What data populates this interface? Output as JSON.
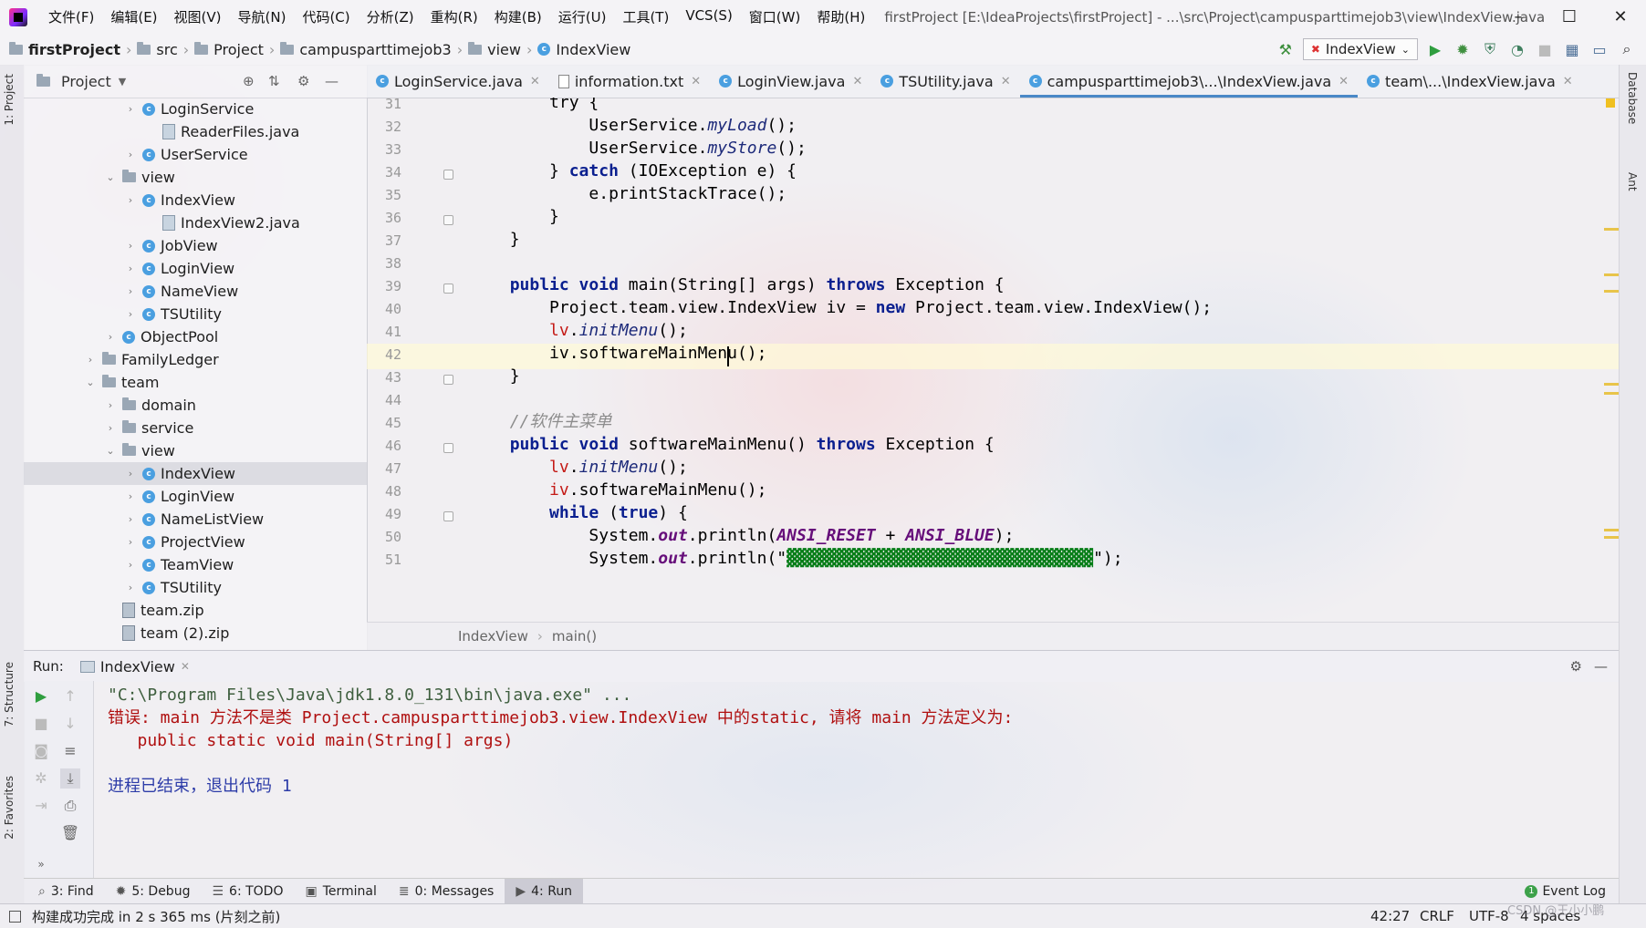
{
  "window": {
    "menus": [
      "文件(F)",
      "编辑(E)",
      "视图(V)",
      "导航(N)",
      "代码(C)",
      "分析(Z)",
      "重构(R)",
      "构建(B)",
      "运行(U)",
      "工具(T)",
      "VCS(S)",
      "窗口(W)",
      "帮助(H)"
    ],
    "title": "firstProject [E:\\IdeaProjects\\firstProject] - ...\\src\\Project\\campusparttimejob3\\view\\IndexView.java"
  },
  "navbar": {
    "crumbs": [
      "firstProject",
      "src",
      "Project",
      "campusparttimejob3",
      "view",
      "IndexView"
    ],
    "run_config": "IndexView"
  },
  "left_stripe": {
    "project": "1: Project",
    "structure": "7: Structure",
    "favorites": "2: Favorites"
  },
  "right_stripe": {
    "database": "Database",
    "ant": "Ant"
  },
  "project_panel": {
    "title": "Project",
    "tree": [
      {
        "label": "LoginService",
        "kind": "class",
        "arrow": "›"
      },
      {
        "label": "ReaderFiles.java",
        "kind": "file",
        "arrow": ""
      },
      {
        "label": "UserService",
        "kind": "class",
        "arrow": "›"
      },
      {
        "label": "view",
        "kind": "folder",
        "arrow": "⌄"
      },
      {
        "label": "IndexView",
        "kind": "class",
        "arrow": "›"
      },
      {
        "label": "IndexView2.java",
        "kind": "file",
        "arrow": ""
      },
      {
        "label": "JobView",
        "kind": "class",
        "arrow": "›"
      },
      {
        "label": "LoginView",
        "kind": "class",
        "arrow": "›"
      },
      {
        "label": "NameView",
        "kind": "class",
        "arrow": "›"
      },
      {
        "label": "TSUtility",
        "kind": "class",
        "arrow": "›"
      },
      {
        "label": "ObjectPool",
        "kind": "class",
        "arrow": "›"
      },
      {
        "label": "FamilyLedger",
        "kind": "folder",
        "arrow": "›"
      },
      {
        "label": "team",
        "kind": "folder",
        "arrow": "⌄"
      },
      {
        "label": "domain",
        "kind": "folder",
        "arrow": "›"
      },
      {
        "label": "service",
        "kind": "folder",
        "arrow": "›"
      },
      {
        "label": "view",
        "kind": "folder",
        "arrow": "⌄"
      },
      {
        "label": "IndexView",
        "kind": "class",
        "arrow": "›"
      },
      {
        "label": "LoginView",
        "kind": "class",
        "arrow": "›"
      },
      {
        "label": "NameListView",
        "kind": "class",
        "arrow": "›"
      },
      {
        "label": "ProjectView",
        "kind": "class",
        "arrow": "›"
      },
      {
        "label": "TeamView",
        "kind": "class",
        "arrow": "›"
      },
      {
        "label": "TSUtility",
        "kind": "class",
        "arrow": "›"
      },
      {
        "label": "team.zip",
        "kind": "zip",
        "arrow": ""
      },
      {
        "label": "team (2).zip",
        "kind": "zip",
        "arrow": ""
      }
    ]
  },
  "editor_tabs": [
    {
      "label": "LoginService.java",
      "icon": "class"
    },
    {
      "label": "information.txt",
      "icon": "text"
    },
    {
      "label": "LoginView.java",
      "icon": "class"
    },
    {
      "label": "TSUtility.java",
      "icon": "class"
    },
    {
      "label": "campusparttimejob3\\...\\IndexView.java",
      "icon": "class",
      "active": true
    },
    {
      "label": "team\\...\\IndexView.java",
      "icon": "class"
    }
  ],
  "editor": {
    "line_numbers": [
      "31",
      "32",
      "33",
      "34",
      "35",
      "36",
      "37",
      "38",
      "39",
      "40",
      "41",
      "42",
      "43",
      "44",
      "45",
      "46",
      "47",
      "48",
      "49",
      "50",
      "51"
    ],
    "lines": [
      [
        {
          "t": "            try {",
          "c": ""
        }
      ],
      [
        {
          "t": "                UserService.",
          "c": ""
        },
        {
          "t": "myLoad",
          "c": "fn-i"
        },
        {
          "t": "();",
          "c": ""
        }
      ],
      [
        {
          "t": "                UserService.",
          "c": ""
        },
        {
          "t": "myStore",
          "c": "fn-i"
        },
        {
          "t": "();",
          "c": ""
        }
      ],
      [
        {
          "t": "            } ",
          "c": ""
        },
        {
          "t": "catch",
          "c": "kw"
        },
        {
          "t": " (IOException e) {",
          "c": ""
        }
      ],
      [
        {
          "t": "                e.printStackTrace();",
          "c": ""
        }
      ],
      [
        {
          "t": "            }",
          "c": ""
        }
      ],
      [
        {
          "t": "        }",
          "c": ""
        }
      ],
      [
        {
          "t": "",
          "c": ""
        }
      ],
      [
        {
          "t": "        ",
          "c": ""
        },
        {
          "t": "public void",
          "c": "kw"
        },
        {
          "t": " main(String[] args) ",
          "c": ""
        },
        {
          "t": "throws",
          "c": "kw"
        },
        {
          "t": " Exception {",
          "c": ""
        }
      ],
      [
        {
          "t": "            Project.team.view.IndexView iv = ",
          "c": ""
        },
        {
          "t": "new",
          "c": "kw"
        },
        {
          "t": " Project.team.view.IndexView();",
          "c": ""
        }
      ],
      [
        {
          "t": "            ",
          "c": ""
        },
        {
          "t": "lv",
          "c": "err"
        },
        {
          "t": ".",
          "c": ""
        },
        {
          "t": "initMenu",
          "c": "fn-i"
        },
        {
          "t": "();",
          "c": ""
        }
      ],
      [
        {
          "t": "            iv.softwareMainMenu();",
          "c": ""
        }
      ],
      [
        {
          "t": "        }",
          "c": ""
        }
      ],
      [
        {
          "t": "",
          "c": ""
        }
      ],
      [
        {
          "t": "        //软件主菜单",
          "c": "cmt"
        }
      ],
      [
        {
          "t": "        ",
          "c": ""
        },
        {
          "t": "public void",
          "c": "kw"
        },
        {
          "t": " softwareMainMenu() ",
          "c": ""
        },
        {
          "t": "throws",
          "c": "kw"
        },
        {
          "t": " Exception {",
          "c": ""
        }
      ],
      [
        {
          "t": "            ",
          "c": ""
        },
        {
          "t": "lv",
          "c": "err"
        },
        {
          "t": ".",
          "c": ""
        },
        {
          "t": "initMenu",
          "c": "fn-i"
        },
        {
          "t": "();",
          "c": ""
        }
      ],
      [
        {
          "t": "            ",
          "c": ""
        },
        {
          "t": "iv",
          "c": "err"
        },
        {
          "t": ".softwareMainMenu();",
          "c": ""
        }
      ],
      [
        {
          "t": "            ",
          "c": ""
        },
        {
          "t": "while",
          "c": "kw"
        },
        {
          "t": " (",
          "c": ""
        },
        {
          "t": "true",
          "c": "kw"
        },
        {
          "t": ") {",
          "c": ""
        }
      ],
      [
        {
          "t": "                System.",
          "c": ""
        },
        {
          "t": "out",
          "c": "field-i"
        },
        {
          "t": ".println(",
          "c": ""
        },
        {
          "t": "ANSI_RESET",
          "c": "field-i"
        },
        {
          "t": " + ",
          "c": ""
        },
        {
          "t": "ANSI_BLUE",
          "c": "field-i"
        },
        {
          "t": ");",
          "c": ""
        }
      ],
      [
        {
          "t": "                System.",
          "c": ""
        },
        {
          "t": "out",
          "c": "field-i"
        },
        {
          "t": ".println(\"",
          "c": ""
        },
        {
          "t": "▓▓▓▓▓▓▓▓▓▓▓▓▓▓▓▓▓▓▓▓▓▓▓▓▓▓▓▓▓▓▓",
          "c": "str"
        },
        {
          "t": "\");",
          "c": ""
        }
      ]
    ]
  },
  "breadcrumb": [
    "IndexView",
    "main()"
  ],
  "run": {
    "label": "Run:",
    "tab": "IndexView",
    "console": [
      {
        "text": "\"C:\\Program Files\\Java\\jdk1.8.0_131\\bin\\java.exe\" ...",
        "color": "#3f5f3f"
      },
      {
        "text": "错误: main 方法不是类 Project.campusparttimejob3.view.IndexView 中的static, 请将 main 方法定义为:",
        "color": "#b01010"
      },
      {
        "text": "   public static void main(String[] args)",
        "color": "#b01010"
      },
      {
        "text": "",
        "color": "#000"
      },
      {
        "text": "进程已结束，退出代码 1",
        "color": "#2d3ca8"
      }
    ]
  },
  "tool_tabs": [
    {
      "label": "3: Find",
      "icon": "search-icon"
    },
    {
      "label": "5: Debug",
      "icon": "bug-icon"
    },
    {
      "label": "6: TODO",
      "icon": "list-icon"
    },
    {
      "label": "Terminal",
      "icon": "terminal-icon"
    },
    {
      "label": "0: Messages",
      "icon": "messages-icon"
    },
    {
      "label": "4: Run",
      "icon": "play-icon",
      "active": true
    }
  ],
  "event_log": "Event Log",
  "status": {
    "message": "构建成功完成 in 2 s 365 ms (片刻之前)",
    "position": "42:27",
    "line_sep": "CRLF",
    "encoding": "UTF-8",
    "indent": "4 spaces",
    "watermark": "CSDN @王小小鹏"
  }
}
